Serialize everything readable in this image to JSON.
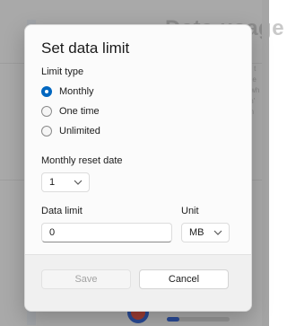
{
  "dialog": {
    "title": "Set data limit",
    "limit_type_label": "Limit type",
    "options": [
      {
        "label": "Monthly",
        "checked": true
      },
      {
        "label": "One time",
        "checked": false
      },
      {
        "label": "Unlimited",
        "checked": false
      }
    ],
    "reset_date_label": "Monthly reset date",
    "reset_date_value": "1",
    "data_limit_label": "Data limit",
    "data_limit_value": "0",
    "unit_label": "Unit",
    "unit_value": "MB",
    "save_label": "Save",
    "cancel_label": "Cancel"
  },
  "background": {
    "title_fragment": "Data usage",
    "text_fragments": [
      "you t",
      "unde",
      "ou wh",
      "won'",
      "plan"
    ]
  },
  "colors": {
    "accent": "#0067c0",
    "disabled_text": "#a3a3a3"
  }
}
